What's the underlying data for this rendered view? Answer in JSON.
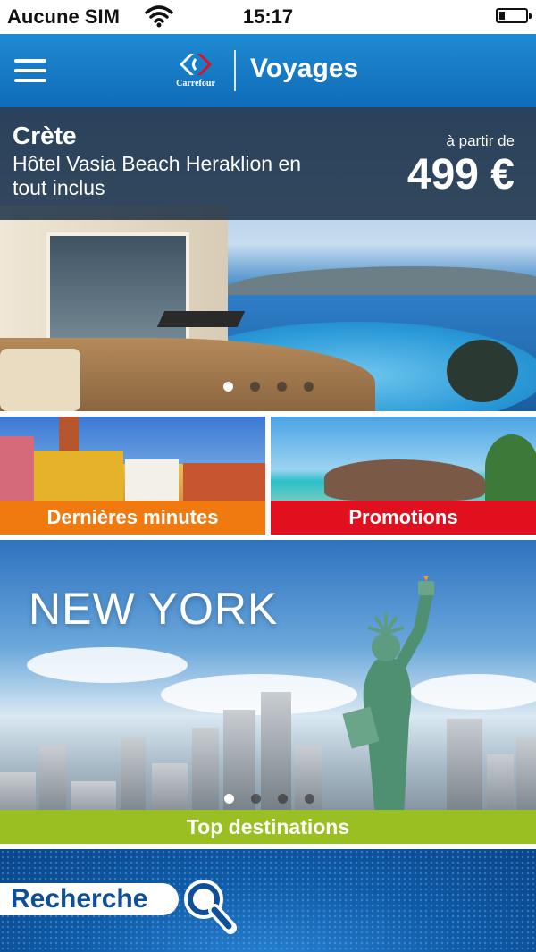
{
  "status_bar": {
    "carrier": "Aucune SIM",
    "time": "15:17"
  },
  "navbar": {
    "brand": "Carrefour",
    "title": "Voyages"
  },
  "hero": {
    "destination": "Crète",
    "hotel": "Hôtel Vasia Beach Heraklion en tout inclus",
    "price_prefix": "à partir de",
    "price": "499 €",
    "slide_count": 4,
    "active_slide": 1
  },
  "tiles": {
    "last_minute": "Dernières minutes",
    "promotions": "Promotions"
  },
  "featured": {
    "city": "NEW YORK",
    "label": "Top destinations",
    "slide_count": 4,
    "active_slide": 1
  },
  "search": {
    "label": "Recherche"
  },
  "colors": {
    "nav_blue": "#1478c4",
    "orange": "#f07a0f",
    "red": "#e0101f",
    "green": "#9abf22",
    "search_blue": "#0f5aa6"
  },
  "icons": [
    "wifi-icon",
    "battery-icon",
    "menu-icon",
    "carrefour-logo-icon",
    "search-icon"
  ]
}
